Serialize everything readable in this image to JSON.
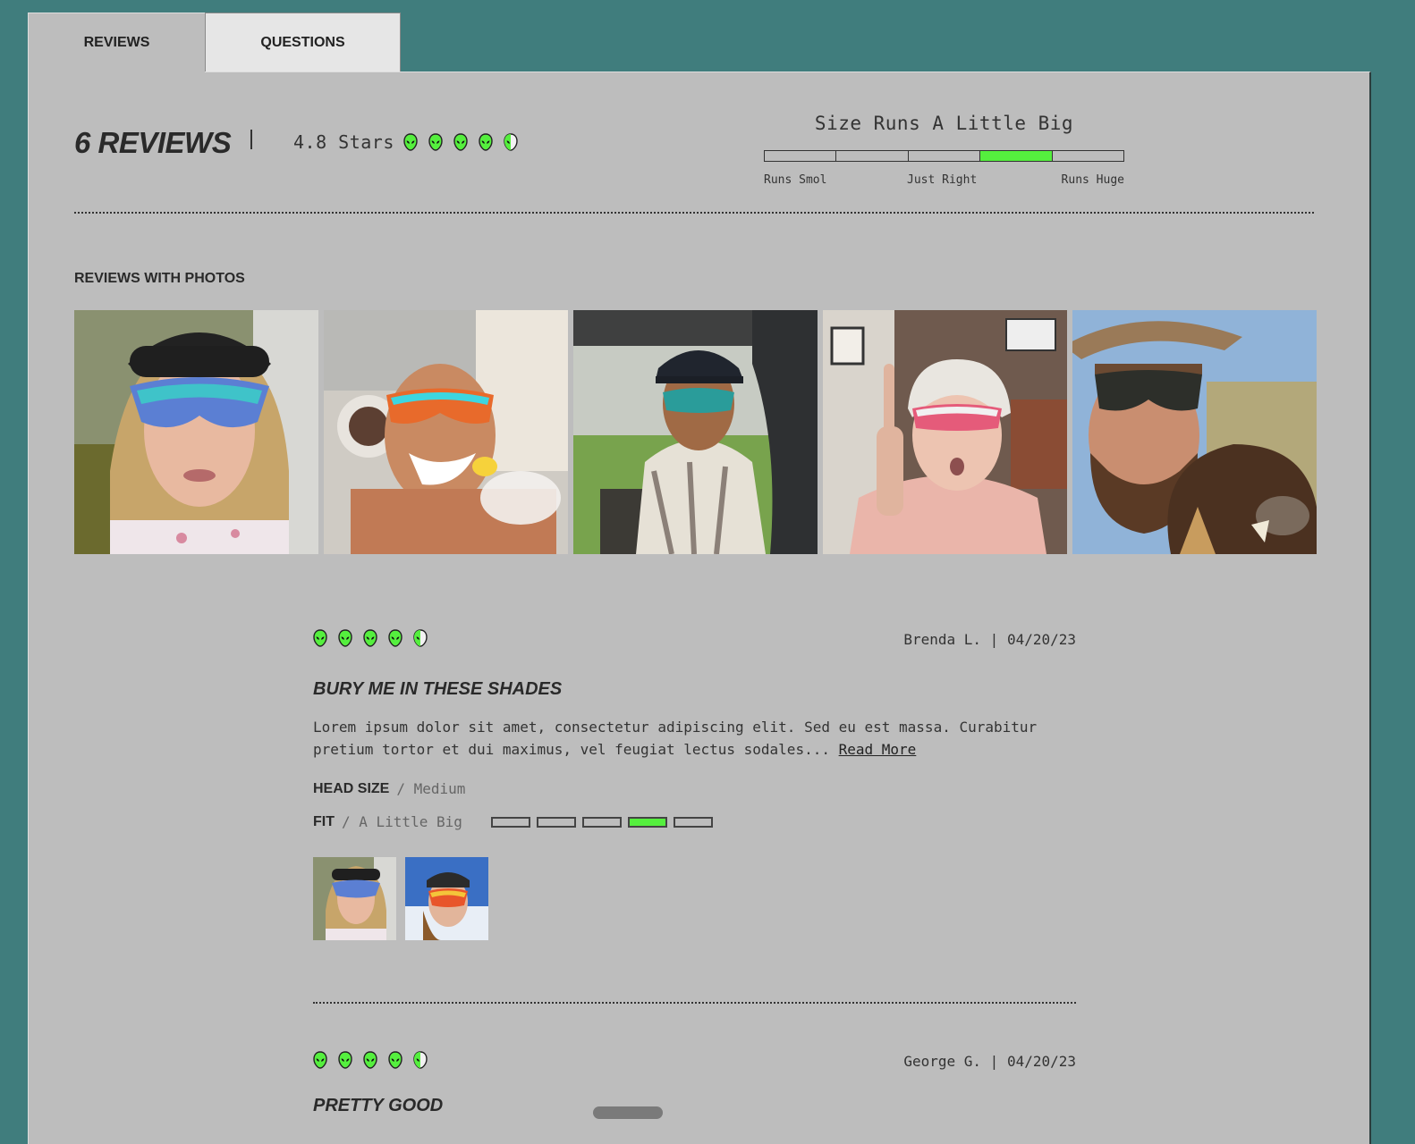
{
  "tabs": [
    {
      "label": "REVIEWS",
      "active": true
    },
    {
      "label": "QUESTIONS",
      "active": false
    }
  ],
  "summary": {
    "count_label": "6 REVIEWS",
    "stars_text": "4.8 Stars",
    "rating": 4.8,
    "icon": "alien-rating-icon"
  },
  "fit": {
    "title": "Size Runs A Little Big",
    "segments": 5,
    "selected_segment": 4,
    "labels": [
      "Runs Smol",
      "Just Right",
      "Runs Huge"
    ]
  },
  "photos": {
    "title": "REVIEWS WITH PHOTOS",
    "items": [
      {
        "name": "review-photo-helmet-woman"
      },
      {
        "name": "review-photo-bathtub-man"
      },
      {
        "name": "review-photo-cap-man"
      },
      {
        "name": "review-photo-grandma"
      },
      {
        "name": "review-photo-boar-man"
      }
    ]
  },
  "reviews": [
    {
      "author_date": "Brenda L. | 04/20/23",
      "rating": 4.5,
      "title": "BURY ME IN THESE SHADES",
      "body": "Lorem ipsum dolor sit amet, consectetur adipiscing elit. Sed eu est massa. Curabitur pretium tortor et dui maximus, vel feugiat lectus sodales...",
      "read_more": "Read More",
      "head_size_label": "HEAD SIZE",
      "head_size_value": "/ Medium",
      "fit_label": "FIT",
      "fit_value": "/ A Little Big",
      "fit_selected": 4
    },
    {
      "author_date": "George G. | 04/20/23",
      "rating": 4.5,
      "title": "PRETTY GOOD"
    }
  ],
  "colors": {
    "background": "#407d7d",
    "panel": "#bdbdbd",
    "accent_green": "#55ef3e"
  }
}
